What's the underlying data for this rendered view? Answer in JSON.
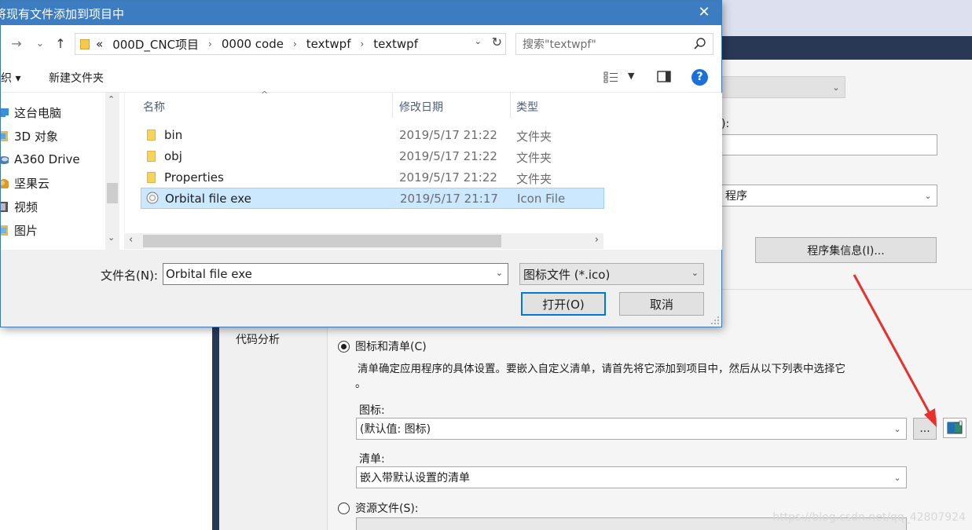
{
  "background": {
    "partial_label_top": "):",
    "partial_combo_text": "程序",
    "assembly_info_button": "程序集信息(I)...",
    "nav_code_analysis": "代码分析",
    "radio_icon_manifest": "图标和清单(C)",
    "manifest_desc_line1": "清单确定应用程序的具体设置。要嵌入自定义清单，请首先将它添加到项目中，然后从以下列表中选择它",
    "manifest_desc_line2": "。",
    "icon_label": "图标:",
    "icon_combo_value": "(默认值: 图标)",
    "browse_button": "...",
    "manifest_label": "清单:",
    "manifest_combo_value": "嵌入带默认设置的清单",
    "radio_resource_file": "资源文件(S):",
    "watermark": "https://blog.csdn.net/qq_42807924"
  },
  "dialog": {
    "title": "将现有文件添加到项目中",
    "close_glyph": "✕",
    "nav": {
      "back": "←",
      "forward": "→",
      "recent": "⌄",
      "up": "↑"
    },
    "address": {
      "overflow": "«",
      "crumbs": [
        "000D_CNC项目",
        "0000 code",
        "textwpf",
        "textwpf"
      ]
    },
    "search_placeholder": "搜索\"textwpf\"",
    "toolbar": {
      "organize": "织 ▾",
      "new_folder": "新建文件夹",
      "help": "?"
    },
    "nav_pane": [
      {
        "label": "这台电脑",
        "icon": "computer-icon",
        "color": "#3b8fd9"
      },
      {
        "label": "3D 对象",
        "icon": "3d-objects-icon",
        "color": "#e8b84a"
      },
      {
        "label": "A360 Drive",
        "icon": "a360-drive-icon",
        "color": "#4a7fa8"
      },
      {
        "label": "坚果云",
        "icon": "nutstore-icon",
        "color": "#d99c2b"
      },
      {
        "label": "视频",
        "icon": "video-icon",
        "color": "#555555"
      },
      {
        "label": "图片",
        "icon": "pictures-icon",
        "color": "#e8b84a"
      }
    ],
    "columns": {
      "name": "名称",
      "modified": "修改日期",
      "type": "类型"
    },
    "files": [
      {
        "name": "bin",
        "modified": "2019/5/17 21:22",
        "type": "文件夹",
        "icon": "folder-icon"
      },
      {
        "name": "obj",
        "modified": "2019/5/17 21:22",
        "type": "文件夹",
        "icon": "folder-icon"
      },
      {
        "name": "Properties",
        "modified": "2019/5/17 21:22",
        "type": "文件夹",
        "icon": "folder-icon"
      },
      {
        "name": "Orbital file exe",
        "modified": "2019/5/17 21:17",
        "type": "Icon File",
        "icon": "icon-file-icon",
        "selected": true
      }
    ],
    "filename_label": "文件名(N):",
    "filename_value": "Orbital file exe",
    "filetype_value": "图标文件 (*.ico)",
    "open_button": "打开(O)",
    "cancel_button": "取消"
  },
  "colors": {
    "titlebar": "#3c7dc1",
    "selection": "#cce8ff",
    "annotation_arrow": "#e8302c",
    "vs_dark": "#293955"
  }
}
